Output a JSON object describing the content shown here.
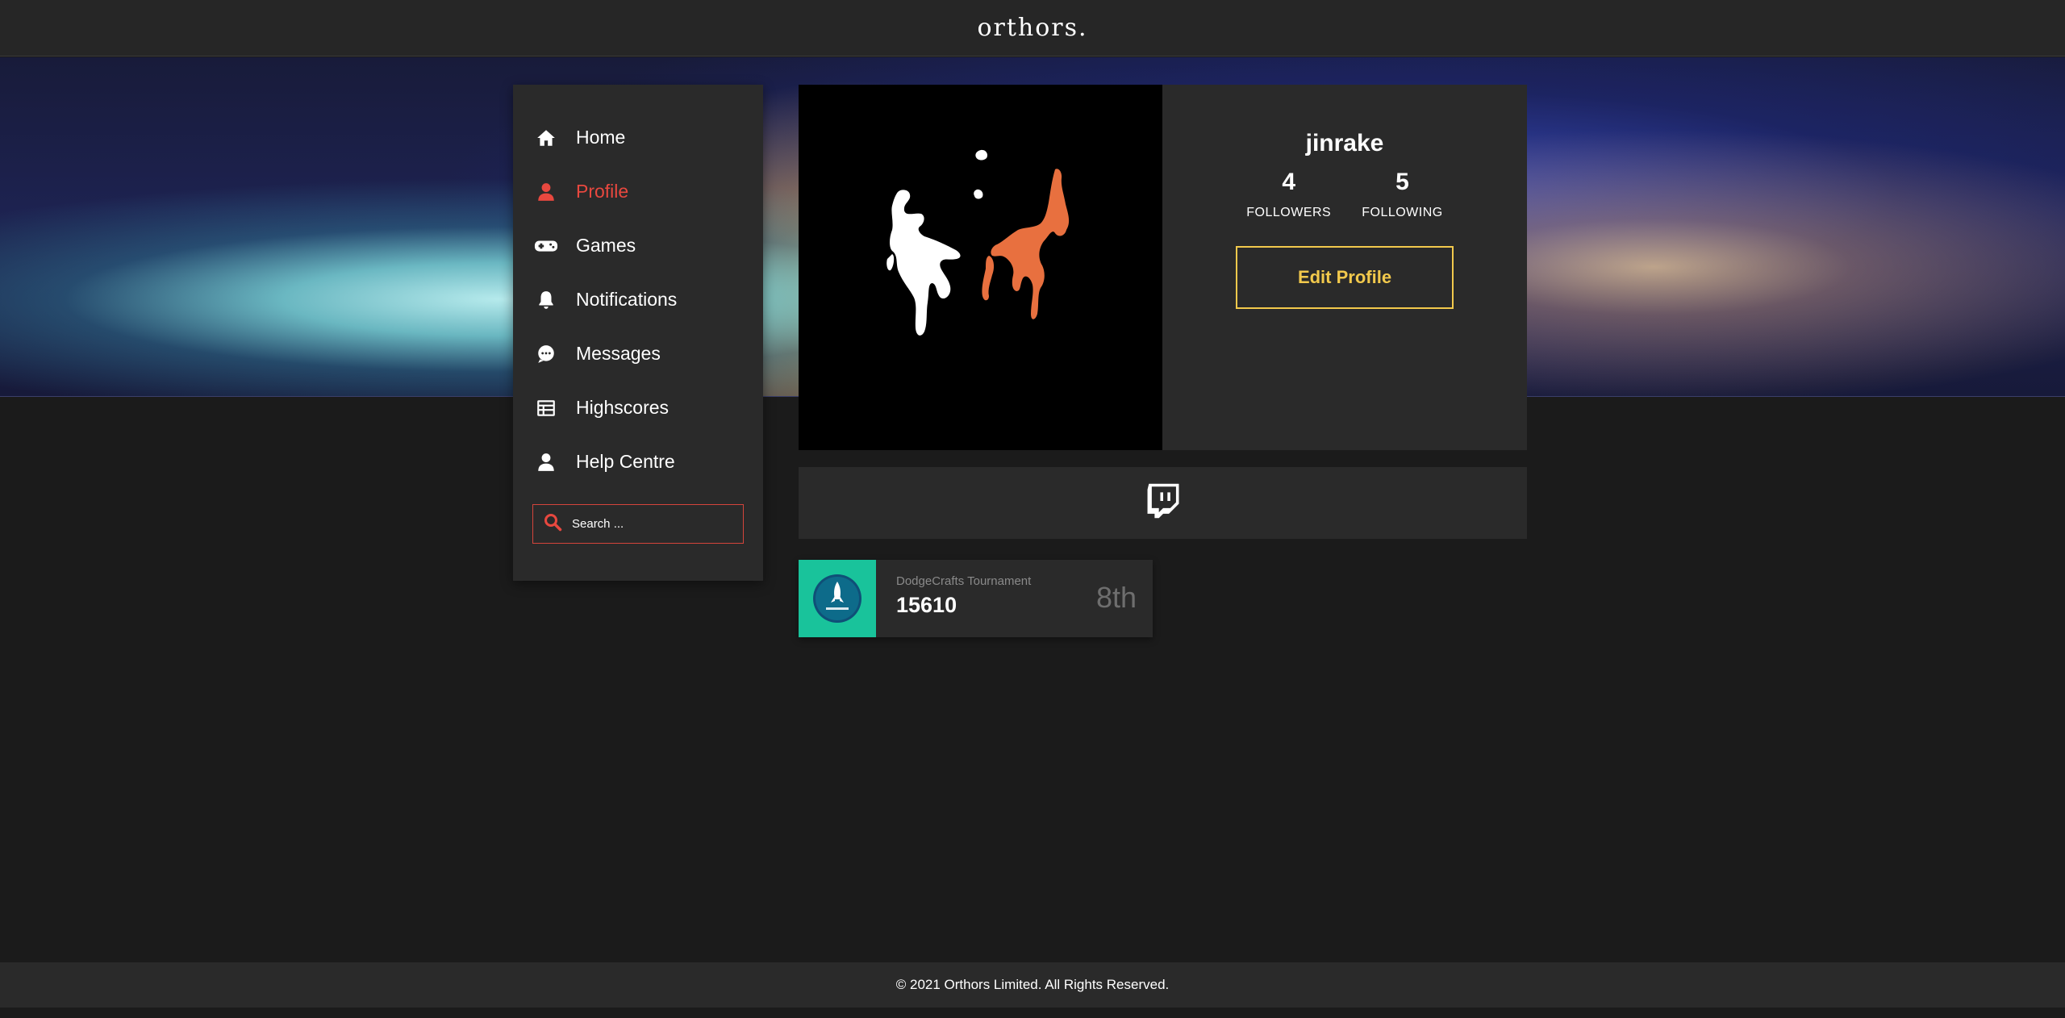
{
  "header": {
    "brand": "orthors."
  },
  "sidebar": {
    "items": [
      {
        "label": "Home",
        "icon": "home-icon",
        "active": false
      },
      {
        "label": "Profile",
        "icon": "user-icon",
        "active": true
      },
      {
        "label": "Games",
        "icon": "gamepad-icon",
        "active": false
      },
      {
        "label": "Notifications",
        "icon": "bell-icon",
        "active": false
      },
      {
        "label": "Messages",
        "icon": "chat-icon",
        "active": false
      },
      {
        "label": "Highscores",
        "icon": "table-icon",
        "active": false
      },
      {
        "label": "Help Centre",
        "icon": "help-user-icon",
        "active": false
      }
    ],
    "search": {
      "placeholder": "Search ..."
    }
  },
  "profile": {
    "username": "jinrake",
    "followers_count": "4",
    "followers_label": "FOLLOWERS",
    "following_count": "5",
    "following_label": "FOLLOWING",
    "edit_button": "Edit Profile"
  },
  "social": {
    "icon": "twitch-icon"
  },
  "scores": [
    {
      "game": "DodgeCrafts Tournament",
      "score": "15610",
      "rank": "8th"
    }
  ],
  "footer": {
    "copyright": "© 2021 Orthors Limited. All Rights Reserved."
  },
  "colors": {
    "accent_red": "#e8483f",
    "accent_yellow": "#f2c94c",
    "panel": "#2a2a2a",
    "background": "#1b1b1b",
    "game_thumb": "#19c39b"
  }
}
